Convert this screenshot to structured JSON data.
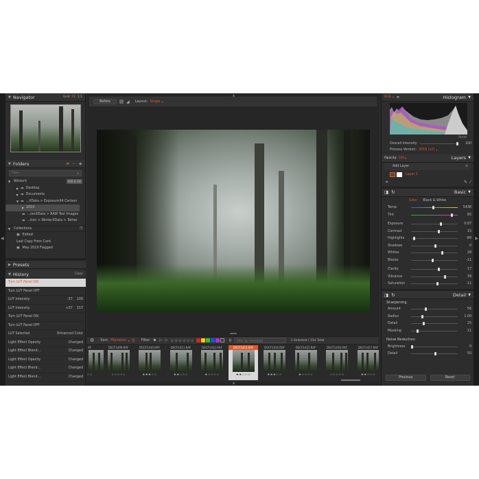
{
  "left": {
    "navigator": {
      "title": "Navigator",
      "grid": "Grid",
      "fit": "Fit",
      "one_to_one": "1:1"
    },
    "folders": {
      "title": "Folders",
      "filter_placeholder": "Filter...",
      "drive": "WinterX",
      "drive_size": "999.6 GB",
      "items": [
        "Desktop",
        "Documents",
        "...XData > ExposureX4 Carlson",
        "2019",
        "...ionXData > RAW Test Images",
        "...tion > WinterXData > Tether"
      ]
    },
    "collections": {
      "title": "Collections",
      "items": [
        "Edited",
        "Last Copy From Card",
        "May 2019 Flagged"
      ]
    },
    "presets": {
      "title": "Presets"
    },
    "history": {
      "title": "History",
      "clear": "Clear",
      "items": [
        {
          "name": "Turn LUT Panel ON",
          "a": "",
          "b": ""
        },
        {
          "name": "Turn LUT Panel OFF",
          "a": "",
          "b": ""
        },
        {
          "name": "LUT Intensity",
          "a": "-57",
          "b": "100"
        },
        {
          "name": "LUT Intensity",
          "a": "+57",
          "b": "157"
        },
        {
          "name": "Turn LUT Panel ON",
          "a": "",
          "b": ""
        },
        {
          "name": "Turn LUT Panel OFF",
          "a": "",
          "b": ""
        },
        {
          "name": "LUT Selected",
          "a": "",
          "b": "Enhanced Color"
        },
        {
          "name": "Light Effect Opacity",
          "a": "",
          "b": "Changed"
        },
        {
          "name": "Light Effect Blend...",
          "a": "",
          "b": "Changed"
        },
        {
          "name": "Light Effect Opacity",
          "a": "",
          "b": "Changed"
        },
        {
          "name": "Light Effect Blend...",
          "a": "",
          "b": "Changed"
        },
        {
          "name": "Light Effect Blend...",
          "a": "",
          "b": "Changed"
        }
      ]
    }
  },
  "toolbar": {
    "before": "Before",
    "layout_label": "Layout:",
    "layout_value": "Single"
  },
  "filmstrip": {
    "sort_label": "Sort:",
    "sort_value": "Filename",
    "filter_label": "Filter:",
    "meta_placeholder": "Filter by metadata",
    "count": "1 Selected / 154 Total",
    "colors": [
      "#e02020",
      "#f0d000",
      "#30c030",
      "#2050e0",
      "#b030d0"
    ],
    "thumbs": [
      {
        "name": "AF",
        "stars": "☆☆"
      },
      {
        "name": "DSCF1409.RAF",
        "stars": "☆☆☆☆☆"
      },
      {
        "name": "DSCF1410.RAF",
        "stars": "★★★☆☆"
      },
      {
        "name": "DSCF1411.RAF",
        "stars": "★★☆☆☆"
      },
      {
        "name": "DSCF1412.RAF",
        "stars": "★☆☆☆☆"
      },
      {
        "name": "DSCF1413.RAF",
        "stars": "★★☆☆☆"
      },
      {
        "name": "DSCF1414.RAF",
        "stars": "★★★☆☆"
      },
      {
        "name": "DSCF1415.RAF",
        "stars": "★☆☆☆☆"
      },
      {
        "name": "DSCF1416.RAF",
        "stars": "☆☆☆☆☆"
      },
      {
        "name": "DSCF1417.RAF",
        "stars": "★★☆☆☆"
      }
    ]
  },
  "right": {
    "histogram": {
      "title": "Histogram",
      "channel": "RGB",
      "reset": "Reset",
      "overall_label": "Overall Intensity",
      "overall_value": "100",
      "process_label": "Process Version:",
      "process_value": "2018 (v2)"
    },
    "layers": {
      "title": "Layers",
      "opacity_label": "Opacity:",
      "opacity_value": "100",
      "add_layer": "Add Layer",
      "layer_name": "Layer 1"
    },
    "basic": {
      "title": "Basic",
      "color_tab": "Color",
      "bw_tab": "Black & White",
      "sliders": [
        {
          "label": "Temp",
          "value": "5438",
          "pos": 0.45
        },
        {
          "label": "Tint",
          "value": "85",
          "pos": 0.85
        },
        {
          "label": "Exposure",
          "value": "0.87",
          "pos": 0.62
        },
        {
          "label": "Contrast",
          "value": "15",
          "pos": 0.58
        },
        {
          "label": "Highlights",
          "value": "-89",
          "pos": 0.05
        },
        {
          "label": "Shadows",
          "value": "0",
          "pos": 0.5
        },
        {
          "label": "Whites",
          "value": "28",
          "pos": 0.64
        },
        {
          "label": "Blacks",
          "value": "-11",
          "pos": 0.44
        },
        {
          "label": "Clarity",
          "value": "17",
          "pos": 0.58
        },
        {
          "label": "Vibrance",
          "value": "39",
          "pos": 0.7
        },
        {
          "label": "Saturation",
          "value": "11",
          "pos": 0.55
        }
      ]
    },
    "detail": {
      "title": "Detail",
      "sharpening": "Sharpening",
      "sliders": [
        {
          "label": "Amount",
          "value": "56",
          "pos": 0.3
        },
        {
          "label": "Radius",
          "value": "1.00",
          "pos": 0.22
        },
        {
          "label": "Detail",
          "value": "25",
          "pos": 0.25
        },
        {
          "label": "Masking",
          "value": "11",
          "pos": 0.12
        }
      ],
      "noise": "Noise Reduction",
      "noise_sliders": [
        {
          "label": "Brightness",
          "value": "0",
          "pos": 0.0
        },
        {
          "label": "Detail",
          "value": "50",
          "pos": 0.5
        }
      ]
    },
    "previous": "Previous",
    "reset": "Reset"
  }
}
